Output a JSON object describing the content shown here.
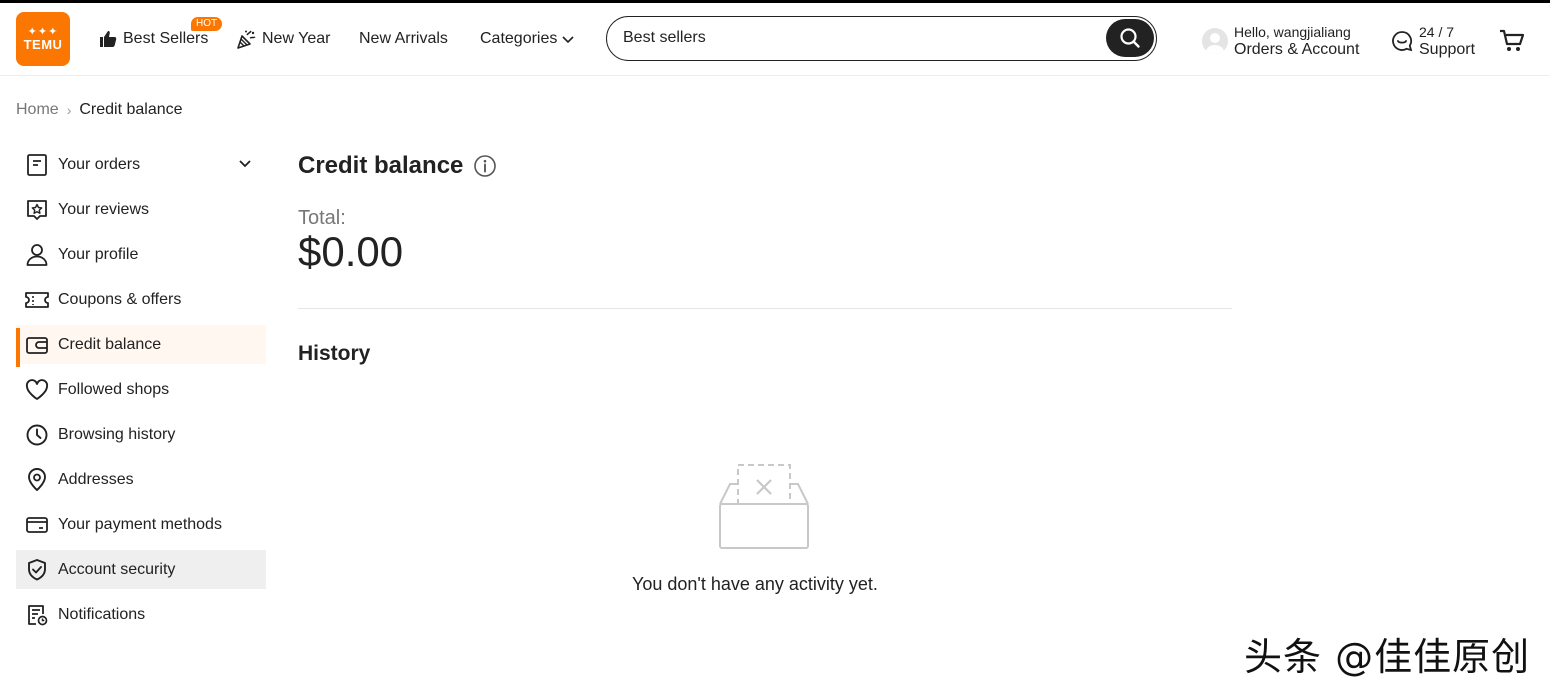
{
  "brand": {
    "logo_glyphs": "✦✦✦",
    "logo_text": "TEMU",
    "accent": "#fb7701"
  },
  "nav": {
    "best_sellers": "Best Sellers",
    "hot_badge": "HOT",
    "new_year": "New Year",
    "new_arrivals": "New Arrivals",
    "categories": "Categories"
  },
  "search": {
    "value": "Best sellers"
  },
  "account": {
    "greeting": "Hello, wangjialiang",
    "label": "Orders & Account"
  },
  "support": {
    "top": "24 / 7",
    "label": "Support"
  },
  "breadcrumb": {
    "home": "Home",
    "separator": "›",
    "current": "Credit balance"
  },
  "sidebar": {
    "items": [
      {
        "label": "Your orders",
        "icon": "orders-icon"
      },
      {
        "label": "Your reviews",
        "icon": "review-icon"
      },
      {
        "label": "Your profile",
        "icon": "profile-icon"
      },
      {
        "label": "Coupons & offers",
        "icon": "coupon-icon"
      },
      {
        "label": "Credit balance",
        "icon": "wallet-icon",
        "active": true
      },
      {
        "label": "Followed shops",
        "icon": "heart-icon"
      },
      {
        "label": "Browsing history",
        "icon": "clock-icon"
      },
      {
        "label": "Addresses",
        "icon": "location-icon"
      },
      {
        "label": "Your payment methods",
        "icon": "card-icon"
      },
      {
        "label": "Account security",
        "icon": "shield-icon",
        "hovered": true
      },
      {
        "label": "Notifications",
        "icon": "notification-icon"
      }
    ]
  },
  "main": {
    "title": "Credit balance",
    "total_label": "Total:",
    "total_value": "$0.00",
    "history_title": "History",
    "empty_text": "You don't have any activity yet."
  },
  "watermark": "头条 @佳佳原创"
}
